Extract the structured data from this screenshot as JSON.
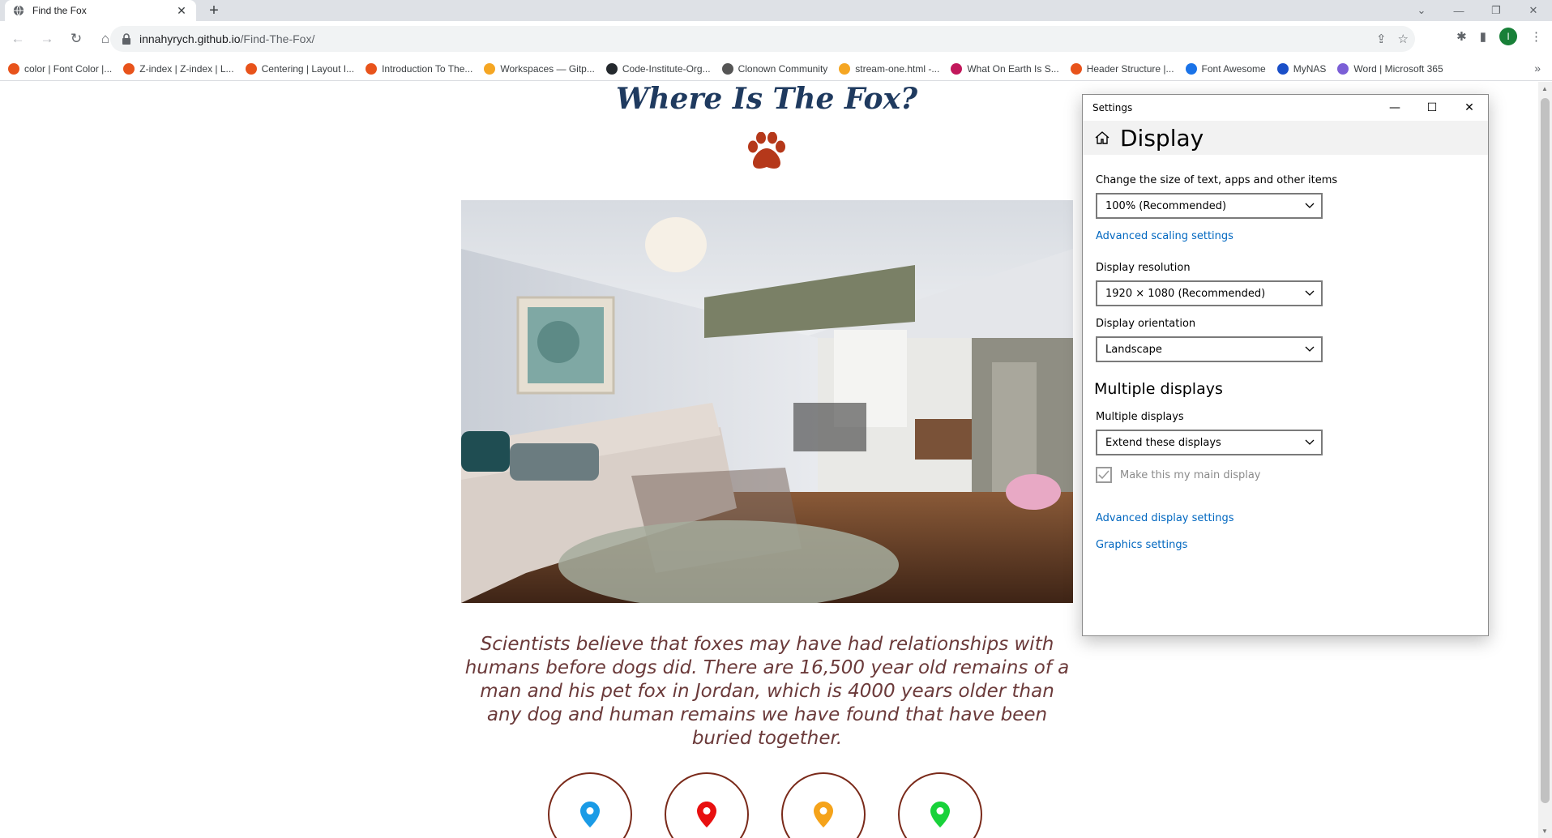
{
  "browser": {
    "tab_title": "Find the Fox",
    "url_host": "innahyrych.github.io",
    "url_path": "/Find-The-Fox/",
    "bookmarks": [
      {
        "label": "color | Font Color |...",
        "color": "#e8531b"
      },
      {
        "label": "Z-index | Z-index | L...",
        "color": "#e8531b"
      },
      {
        "label": "Centering | Layout I...",
        "color": "#e8531b"
      },
      {
        "label": "Introduction To The...",
        "color": "#e8531b"
      },
      {
        "label": "Workspaces — Gitp...",
        "color": "#f5a623"
      },
      {
        "label": "Code-Institute-Org...",
        "color": "#24292e"
      },
      {
        "label": "Clonown Community",
        "color": "#555555"
      },
      {
        "label": "stream-one.html -...",
        "color": "#f5a623"
      },
      {
        "label": "What On Earth Is S...",
        "color": "#c2185b"
      },
      {
        "label": "Header Structure |...",
        "color": "#e8531b"
      },
      {
        "label": "Font Awesome",
        "color": "#1a73e8"
      },
      {
        "label": "MyNAS",
        "color": "#1a4fc8"
      },
      {
        "label": "Word | Microsoft 365",
        "color": "#7b5fd6"
      }
    ],
    "more_bookmarks": "»"
  },
  "page": {
    "heading": "Where Is The Fox?",
    "fact": "Scientists believe that foxes may have had relationships with humans before dogs did. There are 16,500 year old remains of a man and his pet fox in Jordan, which is 4000 years older than any dog and human remains we have found that have been buried together.",
    "pins": [
      {
        "name": "pin-blue",
        "color": "#1a9be6"
      },
      {
        "name": "pin-red",
        "color": "#e81010"
      },
      {
        "name": "pin-orange",
        "color": "#f5a31a"
      },
      {
        "name": "pin-green",
        "color": "#18d23a"
      }
    ],
    "accent_color": "#b5381a"
  },
  "settings": {
    "window_title": "Settings",
    "page_title": "Display",
    "scale_label": "Change the size of text, apps and other items",
    "scale_value": "100% (Recommended)",
    "advanced_scaling": "Advanced scaling settings",
    "resolution_label": "Display resolution",
    "resolution_value": "1920 × 1080 (Recommended)",
    "orientation_label": "Display orientation",
    "orientation_value": "Landscape",
    "multi_section": "Multiple displays",
    "multi_label": "Multiple displays",
    "multi_value": "Extend these displays",
    "main_display_check": "Make this my main display",
    "advanced_display": "Advanced display settings",
    "graphics": "Graphics settings"
  }
}
